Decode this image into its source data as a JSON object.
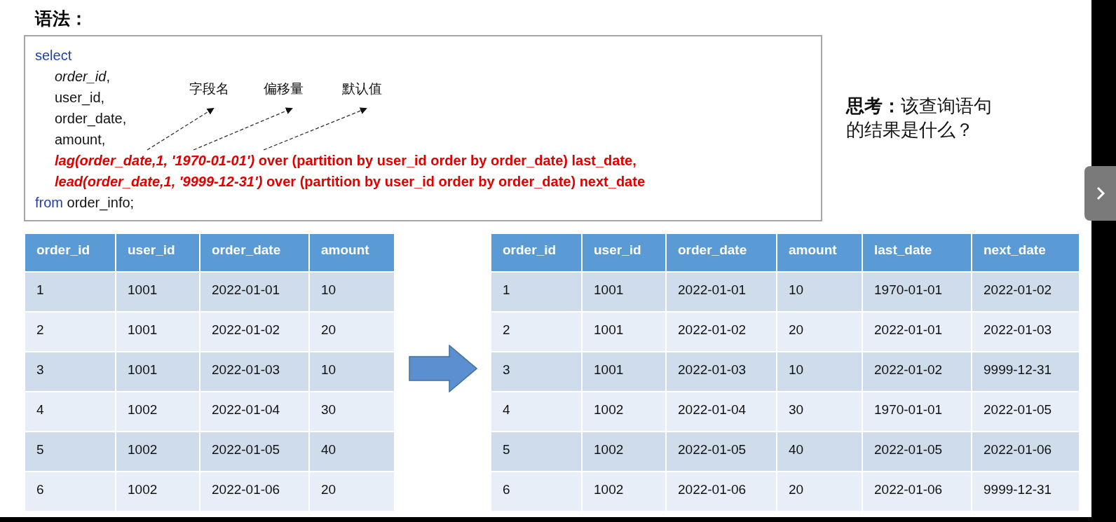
{
  "title": "语法：",
  "code": {
    "lines": [
      {
        "segments": [
          {
            "kind": "keyword",
            "text": "select"
          }
        ],
        "children": [
          {
            "segments": [
              {
                "kind": "italic",
                "text": "order_id"
              },
              {
                "kind": "plain",
                "text": ","
              }
            ]
          },
          {
            "segments": [
              {
                "kind": "plain",
                "text": "user_id,"
              }
            ]
          },
          {
            "segments": [
              {
                "kind": "plain",
                "text": "order_date,"
              }
            ]
          },
          {
            "segments": [
              {
                "kind": "plain",
                "text": "amount,"
              }
            ]
          },
          {
            "segments": [
              {
                "kind": "red-italic",
                "text": "lag(order_date,1, '1970-01-01')"
              },
              {
                "kind": "red",
                "text": " over (partition by user_id order by order_date) last_date,"
              }
            ]
          },
          {
            "segments": [
              {
                "kind": "red-italic",
                "text": "lead(order_date,1, '9999-12-31')"
              },
              {
                "kind": "red",
                "text": " over (partition by user_id order by order_date) next_date"
              }
            ]
          }
        ]
      },
      {
        "segments": [
          {
            "kind": "keyword",
            "text": "from"
          },
          {
            "kind": "plain",
            "text": " order_info;"
          }
        ]
      }
    ],
    "annotations": [
      "字段名",
      "偏移量",
      "默认值"
    ]
  },
  "question": {
    "bold": "思考：",
    "text": "该查询语句的结果是什么？"
  },
  "source_table": {
    "columns": [
      "order_id",
      "user_id",
      "order_date",
      "amount"
    ],
    "rows": [
      [
        "1",
        "1001",
        "2022-01-01",
        "10"
      ],
      [
        "2",
        "1001",
        "2022-01-02",
        "20"
      ],
      [
        "3",
        "1001",
        "2022-01-03",
        "10"
      ],
      [
        "4",
        "1002",
        "2022-01-04",
        "30"
      ],
      [
        "5",
        "1002",
        "2022-01-05",
        "40"
      ],
      [
        "6",
        "1002",
        "2022-01-06",
        "20"
      ]
    ]
  },
  "result_table": {
    "columns": [
      "order_id",
      "user_id",
      "order_date",
      "amount",
      "last_date",
      "next_date"
    ],
    "rows": [
      [
        "1",
        "1001",
        "2022-01-01",
        "10",
        "1970-01-01",
        "2022-01-02"
      ],
      [
        "2",
        "1001",
        "2022-01-02",
        "20",
        "2022-01-01",
        "2022-01-03"
      ],
      [
        "3",
        "1001",
        "2022-01-03",
        "10",
        "2022-01-02",
        "9999-12-31"
      ],
      [
        "4",
        "1002",
        "2022-01-04",
        "30",
        "1970-01-01",
        "2022-01-05"
      ],
      [
        "5",
        "1002",
        "2022-01-05",
        "40",
        "2022-01-05",
        "2022-01-06"
      ],
      [
        "6",
        "1002",
        "2022-01-06",
        "20",
        "2022-01-06",
        "9999-12-31"
      ]
    ]
  }
}
